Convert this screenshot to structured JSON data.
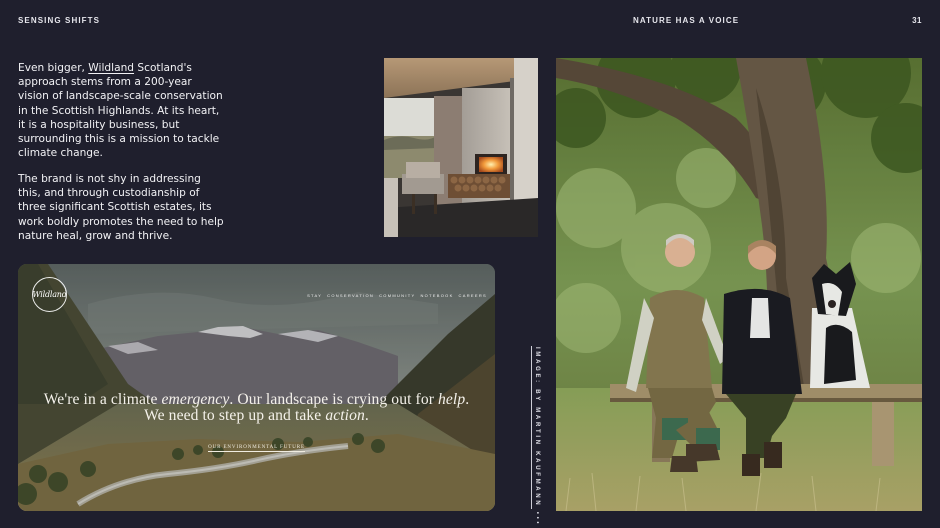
{
  "header": {
    "left": "SENSING SHIFTS",
    "center": "NATURE HAS A VOICE",
    "page_number": "31"
  },
  "body": {
    "para1_before": "Even bigger, ",
    "para1_link": "Wildland",
    "para1_after": " Scotland's approach stems from a 200-year vision of landscape-scale conservation in the Scottish Highlands. At its heart, it is a hospitality business, but surrounding this is a mission to tackle climate change.",
    "para2": "The brand is not shy in addressing this, and through custodianship of three significant Scottish estates, its work boldly promotes the need to help nature heal, grow and thrive."
  },
  "website": {
    "logo_text": "Wildland",
    "nav": [
      "STAY",
      "CONSERVATION",
      "COMMUNITY",
      "NOTEBOOK",
      "CAREERS"
    ],
    "hero_line1_a": "We're in a climate ",
    "hero_line1_em1": "emergency",
    "hero_line1_b": ". Our landscape is crying out for ",
    "hero_line1_em2": "help",
    "hero_line1_c": ".",
    "hero_line2_a": "We need to step up and take ",
    "hero_line2_em": "action",
    "hero_line2_b": ".",
    "cta": "OUR ENVIRONMENTAL FUTURE"
  },
  "credit": "IMAGE: BY MARTIN KAUFMANN",
  "credit_mark": "•••",
  "colors": {
    "background": "#1f1f2d",
    "text": "#ffffff"
  }
}
